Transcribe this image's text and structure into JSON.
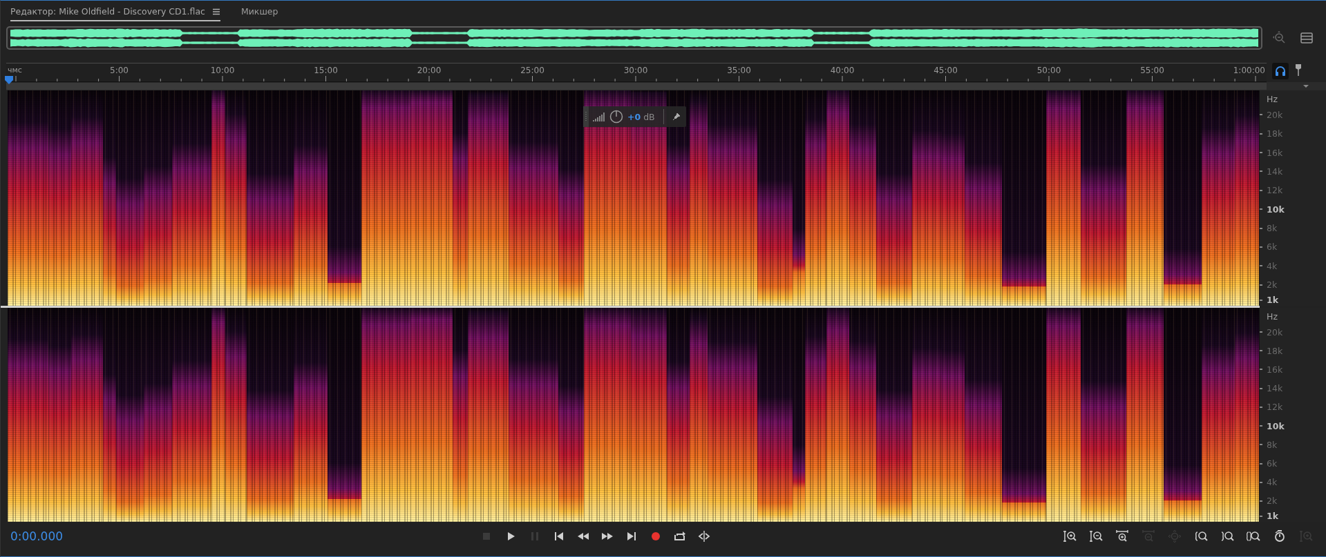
{
  "tabs": [
    {
      "label": "Редактор: Mike Oldfield - Discovery CD1.flac",
      "selected": true,
      "has_menu": true
    },
    {
      "label": "Микшер",
      "selected": false,
      "has_menu": false
    }
  ],
  "ruler": {
    "labels": [
      "чмс",
      "5:00",
      "10:00",
      "15:00",
      "20:00",
      "25:00",
      "30:00",
      "35:00",
      "40:00",
      "45:00",
      "50:00",
      "55:00",
      "1:00:00"
    ],
    "headphones_on": true
  },
  "hud": {
    "gain": "+0",
    "unit": "dB"
  },
  "channels": [
    {
      "axis": [
        {
          "label": "Hz",
          "emphasized": false
        },
        {
          "label": "20k",
          "emphasized": false
        },
        {
          "label": "18k",
          "emphasized": false
        },
        {
          "label": "16k",
          "emphasized": false
        },
        {
          "label": "14k",
          "emphasized": false
        },
        {
          "label": "12k",
          "emphasized": false
        },
        {
          "label": "10k",
          "emphasized": true
        },
        {
          "label": "8k",
          "emphasized": false
        },
        {
          "label": "6k",
          "emphasized": false
        },
        {
          "label": "4k",
          "emphasized": false
        },
        {
          "label": "2k",
          "emphasized": false
        },
        {
          "label": "1k",
          "emphasized": true
        }
      ]
    },
    {
      "axis": [
        {
          "label": "Hz",
          "emphasized": false
        },
        {
          "label": "20k",
          "emphasized": false
        },
        {
          "label": "18k",
          "emphasized": false
        },
        {
          "label": "16k",
          "emphasized": false
        },
        {
          "label": "14k",
          "emphasized": false
        },
        {
          "label": "12k",
          "emphasized": false
        },
        {
          "label": "10k",
          "emphasized": true
        },
        {
          "label": "8k",
          "emphasized": false
        },
        {
          "label": "6k",
          "emphasized": false
        },
        {
          "label": "4k",
          "emphasized": false
        },
        {
          "label": "2k",
          "emphasized": false
        },
        {
          "label": "1k",
          "emphasized": true
        }
      ]
    }
  ],
  "time": "0:00.000",
  "transport": [
    {
      "kind": "stop",
      "disabled": true
    },
    {
      "kind": "play",
      "disabled": false
    },
    {
      "kind": "pause",
      "disabled": true
    },
    {
      "kind": "to-start",
      "disabled": false
    },
    {
      "kind": "rewind",
      "disabled": false
    },
    {
      "kind": "forward",
      "disabled": false
    },
    {
      "kind": "to-end",
      "disabled": false
    },
    {
      "kind": "record",
      "disabled": false
    },
    {
      "kind": "loop",
      "disabled": false
    },
    {
      "kind": "skip",
      "disabled": false
    }
  ],
  "zoom": [
    {
      "kind": "zoom-in-amp",
      "disabled": false
    },
    {
      "kind": "zoom-out-amp",
      "disabled": false
    },
    {
      "kind": "zoom-in-time",
      "disabled": false
    },
    {
      "kind": "zoom-out-time",
      "disabled": true
    },
    {
      "kind": "zoom-full",
      "disabled": true
    },
    {
      "kind": "zoom-in-left",
      "disabled": false
    },
    {
      "kind": "zoom-in-right",
      "disabled": false
    },
    {
      "kind": "zoom-selection",
      "disabled": false
    },
    {
      "kind": "zoom-reset",
      "disabled": false
    },
    {
      "kind": "zoom-in-spectral",
      "disabled": true
    }
  ]
}
